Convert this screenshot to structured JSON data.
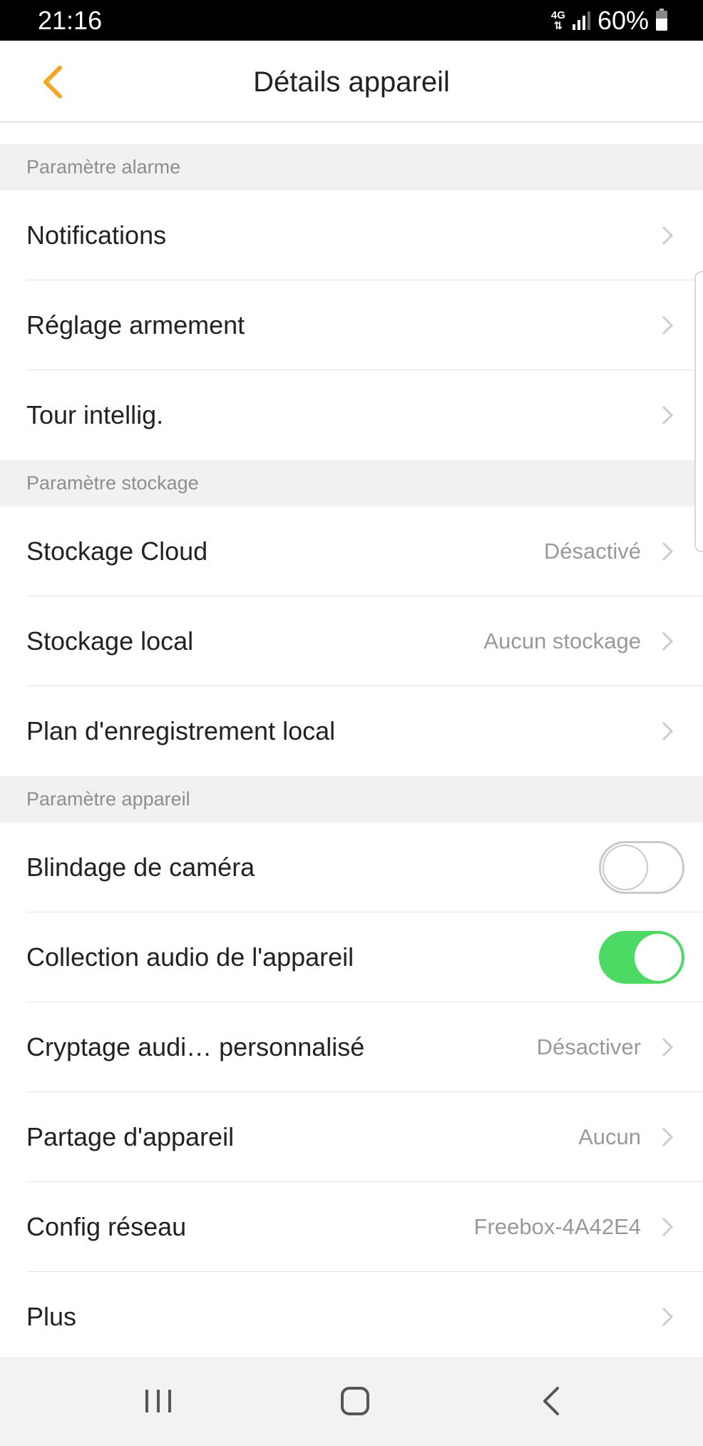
{
  "status_bar": {
    "time": "21:16",
    "network_type": "4G",
    "battery": "60%",
    "icons": [
      "signal-icon",
      "battery-icon"
    ]
  },
  "header": {
    "title": "Détails appareil",
    "back_icon": "chevron-left-icon"
  },
  "accent_color": "#f5a623",
  "toggle_on_color": "#4cd964",
  "sections": {
    "alarm": {
      "title": "Paramètre alarme",
      "rows": [
        {
          "label": "Notifications"
        },
        {
          "label": "Réglage armement"
        },
        {
          "label": "Tour intellig."
        }
      ]
    },
    "storage": {
      "title": "Paramètre stockage",
      "rows": [
        {
          "label": "Stockage Cloud",
          "value": "Désactivé"
        },
        {
          "label": "Stockage local",
          "value": "Aucun stockage"
        },
        {
          "label": "Plan d'enregistrement local"
        }
      ]
    },
    "device": {
      "title": "Paramètre appareil",
      "rows": [
        {
          "label": "Blindage de caméra",
          "toggle": false
        },
        {
          "label": "Collection audio de l'appareil",
          "toggle": true
        },
        {
          "label": "Cryptage audi… personnalisé",
          "value": "Désactiver"
        },
        {
          "label": "Partage d'appareil",
          "value": "Aucun"
        },
        {
          "label": "Config réseau",
          "value": "Freebox-4A42E4"
        },
        {
          "label": "Plus"
        }
      ]
    }
  },
  "nav_bar": {
    "icons": [
      "recent-apps-icon",
      "home-icon",
      "back-icon"
    ]
  }
}
